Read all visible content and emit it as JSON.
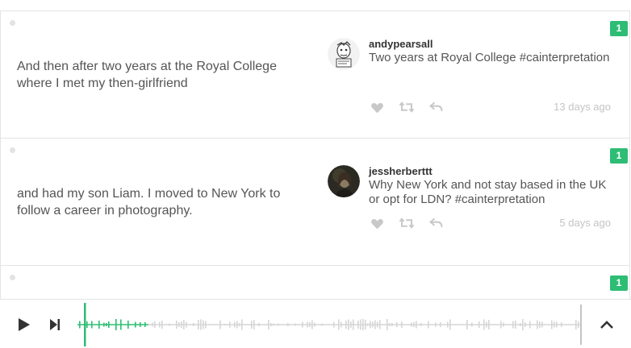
{
  "segments": [
    {
      "transcript": "And then after two years at the Royal College where I met my then-girlfriend",
      "badge_count": "1",
      "tweet": {
        "username": "andypearsall",
        "text": "Two years at Royal College #cainterpretation",
        "time": "13 days ago",
        "avatar": "andypearsall-avatar"
      }
    },
    {
      "transcript": "and had my son Liam. I moved to New York to follow a career in photography.",
      "badge_count": "1",
      "tweet": {
        "username": "jessherberttt",
        "text": "Why New York and not stay based in the UK or opt for LDN? #cainterpretation",
        "time": "5 days ago",
        "avatar": "jessherberttt-avatar"
      }
    },
    {
      "badge_count": "1"
    }
  ],
  "player": {
    "play_icon": "play-icon",
    "next_icon": "skip-next-icon",
    "expand_icon": "chevron-up-icon",
    "progress": 0.014,
    "played_color": "#2ebd74",
    "unplayed_color": "#d6d6d6"
  },
  "colors": {
    "accent": "#2ebd74",
    "text": "#555555",
    "muted": "#c4c4c4",
    "border": "#e4e4e4"
  }
}
